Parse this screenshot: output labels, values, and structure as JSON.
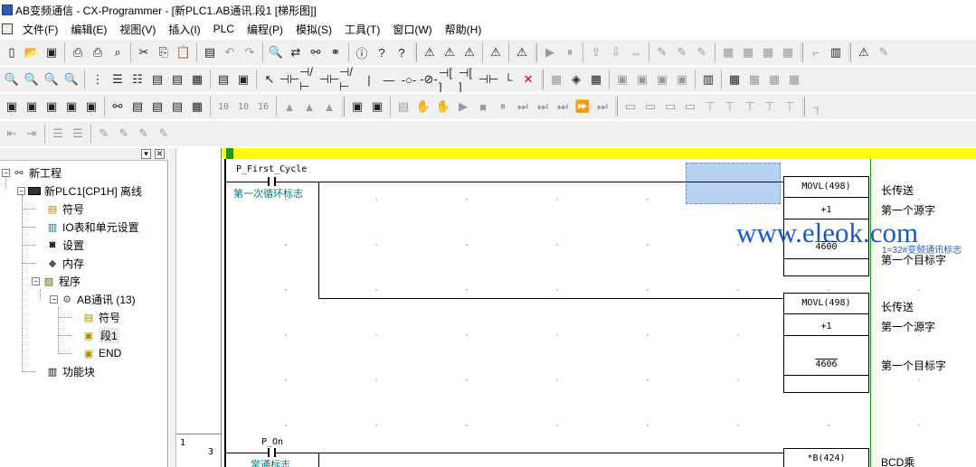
{
  "window": {
    "title": "AB变频通信 - CX-Programmer - [新PLC1.AB通讯.段1 [梯形图]]"
  },
  "menu": {
    "items": [
      "文件(F)",
      "编辑(E)",
      "视图(V)",
      "插入(I)",
      "PLC",
      "编程(P)",
      "模拟(S)",
      "工具(T)",
      "窗口(W)",
      "帮助(H)"
    ]
  },
  "toolbar3": {
    "num_labels": [
      "10",
      "10",
      "16"
    ]
  },
  "tree": {
    "nodes": {
      "project": "新工程",
      "plc": "新PLC1[CP1H] 离线",
      "symbols": "符号",
      "io_table": "IO表和单元设置",
      "settings": "设置",
      "memory": "内存",
      "programs": "程序",
      "task": "AB通讯 (13)",
      "task_symbols": "符号",
      "section1": "段1",
      "end": "END",
      "function_blocks": "功能块"
    }
  },
  "ladder": {
    "rung2": {
      "number": "1",
      "step": "3",
      "contact": "P_On",
      "contact_comment": "常通标志",
      "instruction": "*B(424)",
      "instr_comment": "BCD乘"
    },
    "rung1": {
      "contact": "P_First_Cycle",
      "contact_comment": "第一次循环标志",
      "mov1": {
        "name": "MOVL(498)",
        "source": "+1",
        "dest": "4600",
        "comment_name": "长传送",
        "comment_source": "第一个源字",
        "comment_dest": "第一个目标字",
        "dest_symbol": "1=32#变频通讯标志"
      },
      "mov2": {
        "name": "MOVL(498)",
        "source": "+1",
        "dest": "4606",
        "comment_name": "长传送",
        "comment_source": "第一个源字",
        "comment_dest": "第一个目标字"
      }
    }
  },
  "watermark": "www.eleok.com",
  "colors": {
    "section_bar": "#ffff00",
    "comment_teal": "#007878",
    "cursor_fill": "#b6d2f0",
    "right_rail": "#1a9a1a"
  }
}
